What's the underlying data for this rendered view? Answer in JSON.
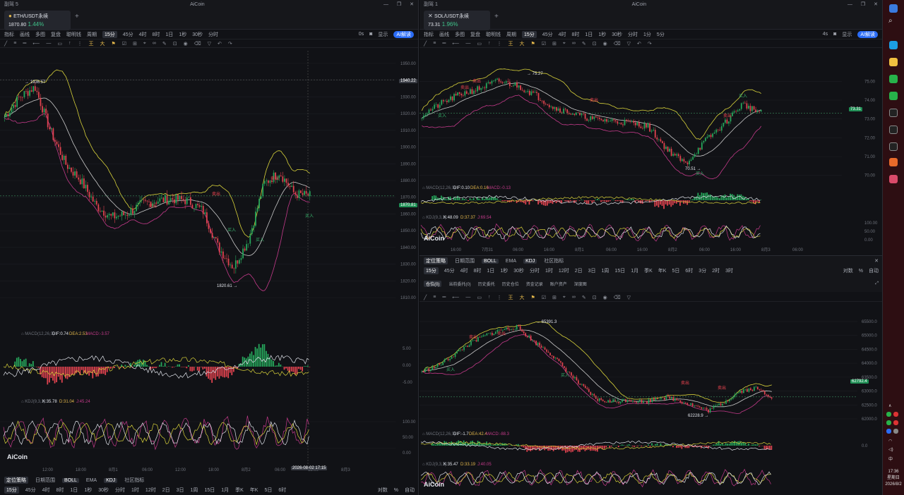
{
  "left_window": {
    "title": "副驾 5",
    "app_name": "AiCoin",
    "tab": {
      "symbol": "ETH/USDT永续",
      "price": "1870.80",
      "change": "1.44%"
    },
    "toolbar": [
      "指标",
      "画线",
      "多图",
      "复盘",
      "聪明钱",
      "周期"
    ],
    "periods": [
      "15分",
      "45分",
      "4时",
      "8时",
      "1日",
      "1秒",
      "30秒",
      "分时",
      "0s"
    ],
    "active_period": "15分",
    "display_label": "显示",
    "ai_label": "AI解读",
    "price_axis": [
      "1950.00",
      "1940.00",
      "1930.00",
      "1920.00",
      "1910.00",
      "1900.00",
      "1890.00",
      "1880.00",
      "1870.00",
      "1860.00",
      "1850.00",
      "1840.00",
      "1830.00",
      "1820.00",
      "1810.00"
    ],
    "current_price": "1870.81",
    "cross_price": "1940.22",
    "high_label": "1936.57",
    "low_label": "1820.61",
    "macd_label": "MACD(12,26,9)",
    "macd_values": {
      "dif": "DIF:0.74",
      "dea": "DEA:2.53",
      "macd": "MACD:-3.57"
    },
    "macd_axis": [
      "5.00",
      "0.00",
      "-5.00"
    ],
    "kdj_label": "KDJ(9,3,3)",
    "kdj_values": {
      "k": "K:35.78",
      "d": "D:31.04",
      "j": "J:45.24"
    },
    "kdj_axis": [
      "100.00",
      "50.00",
      "0.00"
    ],
    "time_axis": [
      "12:00",
      "18:00",
      "8月1",
      "06:00",
      "12:00",
      "18:00",
      "8月2",
      "06:00",
      "12:00",
      "8月3"
    ],
    "cross_time": "2026-08-02 17:15",
    "signals": [
      "卖出",
      "卖出",
      "卖出",
      "买入",
      "买入",
      "买入"
    ],
    "bottom_left": [
      "定位策略",
      "日期范围",
      "BOLL",
      "EMA",
      "KDJ",
      "社区指标"
    ],
    "bottom_periods": [
      "15分",
      "45分",
      "4时",
      "8时",
      "1日",
      "1秒",
      "30秒",
      "分时",
      "1时",
      "12时",
      "2日",
      "3日",
      "1周",
      "15日",
      "1月",
      "季K",
      "年K",
      "5日",
      "6时"
    ],
    "bottom_right": [
      "对数",
      "%",
      "自动"
    ],
    "logo": "AiCoin"
  },
  "right_window": {
    "title": "副驾 1",
    "app_name": "AiCoin",
    "tab": {
      "symbol": "SOL/USDT永续",
      "price": "73.31",
      "change": "1.96%"
    },
    "toolbar": [
      "指标",
      "画线",
      "多图",
      "复盘",
      "聪明钱",
      "周期"
    ],
    "periods": [
      "15分",
      "45分",
      "4时",
      "8时",
      "1日",
      "1秒",
      "30秒",
      "分时",
      "1分",
      "5分",
      "4s"
    ],
    "active_period": "15分",
    "display_label": "显示",
    "ai_label": "AI解读",
    "price_axis": [
      "75.00",
      "74.00",
      "73.00",
      "72.00",
      "71.00",
      "70.00"
    ],
    "current_price": "73.31",
    "high_label": "75.27",
    "low_label": "70.51",
    "macd_label": "MACD(12,26,9)",
    "macd_values": {
      "dif": "DIF:0.10",
      "dea": "DEA:0.16",
      "macd": "MACD:-0.13"
    },
    "kdj_label": "KDJ(9,3,3)",
    "kdj_values": {
      "k": "K:48.09",
      "d": "D:37.37",
      "j": "J:69.54"
    },
    "kdj_axis": [
      "100.00",
      "50.00",
      "0.00"
    ],
    "time_axis": [
      "16:00",
      "7月31",
      "06:00",
      "16:00",
      "8月1",
      "06:00",
      "16:00",
      "8月2",
      "06:00",
      "16:00",
      "8月3",
      "06:00"
    ],
    "signals": [
      "卖出",
      "卖出",
      "卖出",
      "卖出",
      "买入",
      "买入",
      "买入"
    ],
    "panel": {
      "row1": [
        "定位策略",
        "日期范围",
        "BOLL",
        "EMA",
        "KDJ",
        "社区指标"
      ],
      "row2": [
        "15分",
        "45分",
        "4时",
        "8时",
        "1日",
        "1秒",
        "30秒",
        "分时",
        "1时",
        "12时",
        "2日",
        "3日",
        "1周",
        "15日",
        "1月",
        "季K",
        "年K",
        "5日",
        "6时",
        "3分",
        "2时",
        "3时"
      ],
      "row2_right": [
        "对数",
        "%",
        "自动"
      ],
      "row3": [
        "仓位(0)",
        "当前委托(0)",
        "历史委托",
        "历史仓位",
        "资金记录",
        "账户资产",
        "深度图"
      ]
    },
    "btc": {
      "price_axis": [
        "65500.0",
        "65000.0",
        "64500.0",
        "64000.0",
        "63500.0",
        "63000.0",
        "62500.0",
        "62000.0"
      ],
      "current_price": "62792.4",
      "high_label": "65391.3",
      "low_label": "62228.9",
      "macd_label": "MACD(12,26,9)",
      "macd_values": {
        "dif": "DIF:-1.7",
        "dea": "DEA:42.4",
        "macd": "MACD:-88.3"
      },
      "macd_axis": [
        "0.0"
      ],
      "kdj_label": "KDJ(9,3,3)",
      "kdj_values": {
        "k": "K:35.47",
        "d": "D:33.19",
        "j": "J:40.05"
      },
      "signals": [
        "卖出",
        "卖出",
        "卖出",
        "卖出",
        "买入",
        "买入",
        "买入"
      ]
    },
    "logo": "AiCoin"
  },
  "taskbar": {
    "time": "17:36",
    "weekday": "星期日",
    "date": "2026/8/2",
    "ime": "中"
  },
  "colors": {
    "up": "#26a65b",
    "down": "#e0434f",
    "accent": "#2a6cf6",
    "boll_upper": "#d8d23a",
    "boll_mid": "#c9c9c9",
    "boll_lower": "#c43a8a"
  }
}
